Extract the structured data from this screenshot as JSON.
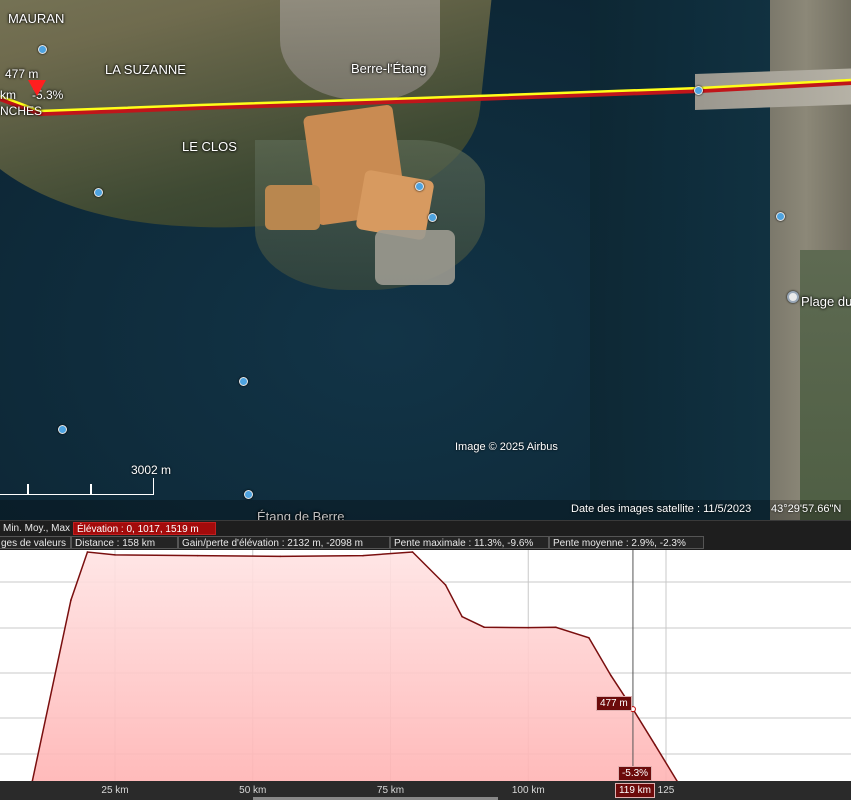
{
  "map": {
    "place_labels": {
      "mauran": "MAURAN",
      "la_suzanne": "LA SUZANNE",
      "le_clos": "LE CLOS",
      "berre": "Berre-l'Étang",
      "plage": "Plage du",
      "etang": "Étang de Berre",
      "anches": "NCHES"
    },
    "cursor": {
      "elevation": "477 m",
      "slope": "-5.3%",
      "unit_fragment": "km"
    },
    "scale": {
      "label": "3002  m"
    },
    "footer": {
      "imagery_date": "Date des images satellite : 11/5/2023",
      "coordinate": "43°29'57.66\"N",
      "copyright": "Image © 2025 Airbus"
    },
    "colors": {
      "track": "#ffff1a",
      "track_shadow": "#c0151a",
      "cursor": "#ff1f1f"
    }
  },
  "stats": {
    "row1": {
      "minmax_label": "Min. Moy., Max",
      "elevation": "Élévation : 0, 1017, 1519 m"
    },
    "row2": {
      "range_label": "ges de valeurs",
      "distance": "Distance : 158 km",
      "gain": "Gain/perte d'élévation : 2132 m, -2098 m",
      "max_slope": "Pente maximale : 11.3%, -9.6%",
      "avg_slope": "Pente moyenne : 2.9%, -2.3%"
    }
  },
  "profile": {
    "x_ticks": [
      "25 km",
      "50 km",
      "75 km",
      "100 km",
      "125"
    ],
    "cursor": {
      "elevation": "477 m",
      "slope": "-5.3%",
      "distance": "119 km"
    },
    "colors": {
      "fill": "#ffd6d6",
      "line": "#7a0f0f",
      "grid": "#c8c8c8",
      "cursor_line": "#555555"
    }
  },
  "chart_data": {
    "type": "area",
    "xlabel": "",
    "ylabel": "",
    "x": [
      10,
      17,
      20,
      25,
      40,
      55,
      70,
      79,
      85,
      88,
      92,
      100,
      105,
      111,
      115,
      119,
      123,
      127
    ],
    "y": [
      0,
      1200,
      1519,
      1500,
      1495,
      1490,
      1495,
      1519,
      1300,
      1090,
      1020,
      1017,
      1020,
      950,
      700,
      477,
      240,
      0
    ],
    "xlim": [
      10,
      127
    ],
    "ylim": [
      0,
      1519
    ],
    "grid": true
  }
}
